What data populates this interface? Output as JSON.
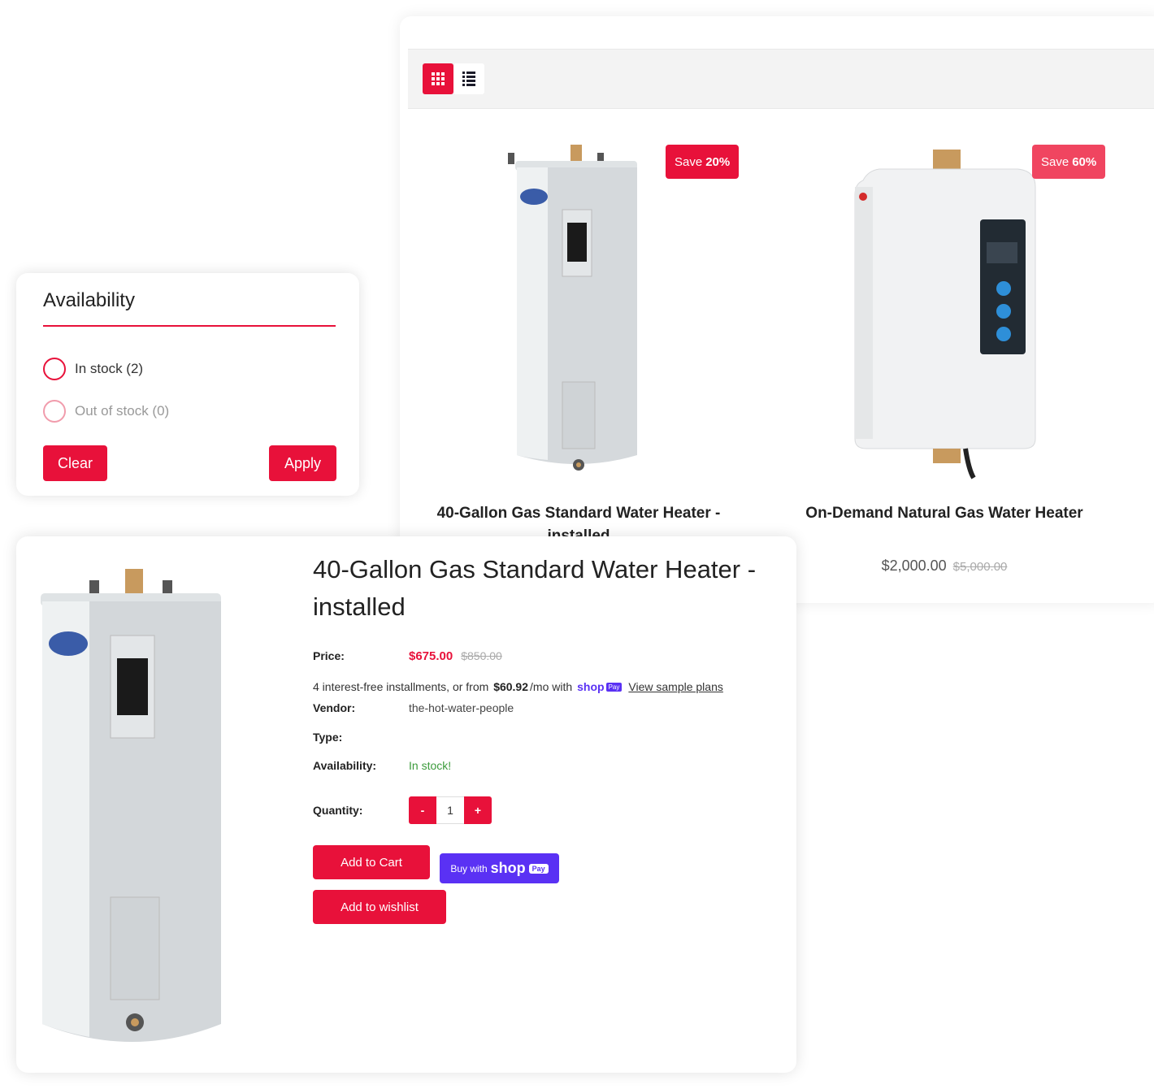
{
  "grid_view": {
    "grid_icon": "grid-icon",
    "list_icon": "list-icon",
    "products": [
      {
        "save_prefix": "Save",
        "save_percent": "20%",
        "title": "40-Gallon Gas Standard Water Heater - installed",
        "image": "tank-water-heater-image"
      },
      {
        "save_prefix": "Save",
        "save_percent": "60%",
        "title": "On-Demand Natural Gas Water Heater",
        "price": "$2,000.00",
        "compare_price": "$5,000.00",
        "image": "tankless-water-heater-image"
      }
    ]
  },
  "filter": {
    "title": "Availability",
    "options": [
      {
        "label": "In stock (2)"
      },
      {
        "label": "Out of stock (0)"
      }
    ],
    "clear_label": "Clear",
    "apply_label": "Apply"
  },
  "detail": {
    "title": "40-Gallon Gas Standard Water Heater - installed",
    "price_label": "Price:",
    "price": "$675.00",
    "compare_price": "$850.00",
    "installments_prefix": "4 interest-free installments, or from",
    "installments_amount": "$60.92",
    "installments_suffix": "/mo with",
    "shop_brand": "shop",
    "pay_tag": "Pay",
    "sample_link": "View sample plans",
    "vendor_label": "Vendor:",
    "vendor": "the-hot-water-people",
    "type_label": "Type:",
    "availability_label": "Availability:",
    "availability": "In stock!",
    "quantity_label": "Quantity:",
    "minus": "-",
    "quantity": "1",
    "plus": "+",
    "add_to_cart": "Add to Cart",
    "buy_with": "Buy with",
    "add_to_wishlist": "Add to wishlist"
  },
  "colors": {
    "accent": "#e8113a",
    "shop_pay": "#5a31f4",
    "in_stock": "#3c9b3c"
  }
}
